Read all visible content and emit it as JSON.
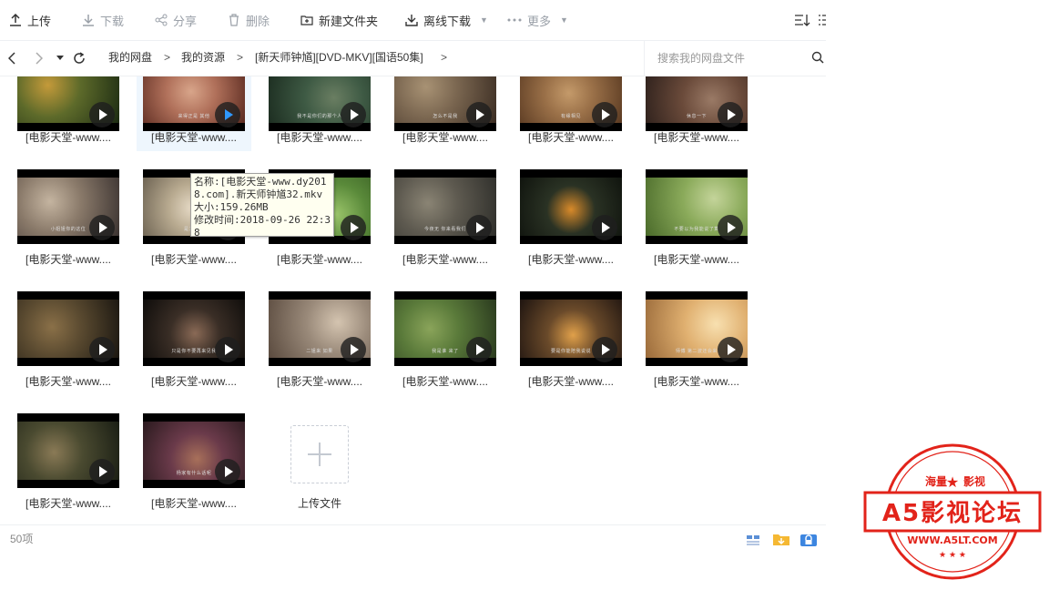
{
  "toolbar": {
    "upload": "上传",
    "download": "下载",
    "share": "分享",
    "delete": "删除",
    "new_folder": "新建文件夹",
    "offline_download": "离线下载",
    "more": "更多"
  },
  "nav": {
    "breadcrumb": [
      "我的网盘",
      "我的资源",
      "[新天师钟馗][DVD-MKV][国语50集]"
    ],
    "separator": ">",
    "search_placeholder": "搜索我的网盘文件"
  },
  "files": [
    {
      "name": "[电影天堂-www....",
      "subtitle": "",
      "scene": "temple-night"
    },
    {
      "name": "[电影天堂-www....",
      "subtitle": "来得正是 其他",
      "scene": "red-room"
    },
    {
      "name": "[电影天堂-www....",
      "subtitle": "我不是你们的那个人",
      "scene": "dark-forest"
    },
    {
      "name": "[电影天堂-www....",
      "subtitle": "怎么不是我",
      "scene": "hall"
    },
    {
      "name": "[电影天堂-www....",
      "subtitle": "有缘相见",
      "scene": "wood-room"
    },
    {
      "name": "[电影天堂-www....",
      "subtitle": "休息一下",
      "scene": "interior"
    },
    {
      "name": "[电影天堂-www....",
      "subtitle": "小姐姐你的这位",
      "scene": "court"
    },
    {
      "name": "[电影天堂-www....",
      "subtitle": "是怎么了",
      "scene": "white-fairy"
    },
    {
      "name": "[电影天堂-www....",
      "subtitle": "",
      "scene": "green"
    },
    {
      "name": "[电影天堂-www....",
      "subtitle": "今夜无 你来看我们",
      "scene": "corridor"
    },
    {
      "name": "[电影天堂-www....",
      "subtitle": "",
      "scene": "lantern"
    },
    {
      "name": "[电影天堂-www....",
      "subtitle": "不要以为我能说了算",
      "scene": "garden-girl"
    },
    {
      "name": "[电影天堂-www....",
      "subtitle": "",
      "scene": "dusk"
    },
    {
      "name": "[电影天堂-www....",
      "subtitle": "只是你不要再来见我",
      "scene": "dark-lady"
    },
    {
      "name": "[电影天堂-www....",
      "subtitle": "二姐来 如果",
      "scene": "courtyard"
    },
    {
      "name": "[电影天堂-www....",
      "subtitle": "我是谁 来了",
      "scene": "bars"
    },
    {
      "name": "[电影天堂-www....",
      "subtitle": "要是你能陪我说说",
      "scene": "lamp-man"
    },
    {
      "name": "[电影天堂-www....",
      "subtitle": "师傅 第二波还会来",
      "scene": "goddess"
    },
    {
      "name": "[电影天堂-www....",
      "subtitle": "",
      "scene": "young-man"
    },
    {
      "name": "[电影天堂-www....",
      "subtitle": "杨家有什么话呢",
      "scene": "banquet"
    }
  ],
  "upload_tile": {
    "label": "上传文件"
  },
  "tooltip": {
    "line1": "名称:[电影天堂-www.dy2018.com].新天师钟馗32.mkv",
    "line2": "大小:159.26MB",
    "line3": "修改时间:2018-09-26 22:38"
  },
  "footer": {
    "count": "50项"
  },
  "watermark": {
    "top": "海量",
    "top2": "影视",
    "main": "A5影视论坛",
    "url": "WWW.A5LT.COM"
  },
  "colors": {
    "accent": "#2f98ff",
    "selected_bg": "#eef6fd",
    "stamp_red": "#e2231a"
  }
}
